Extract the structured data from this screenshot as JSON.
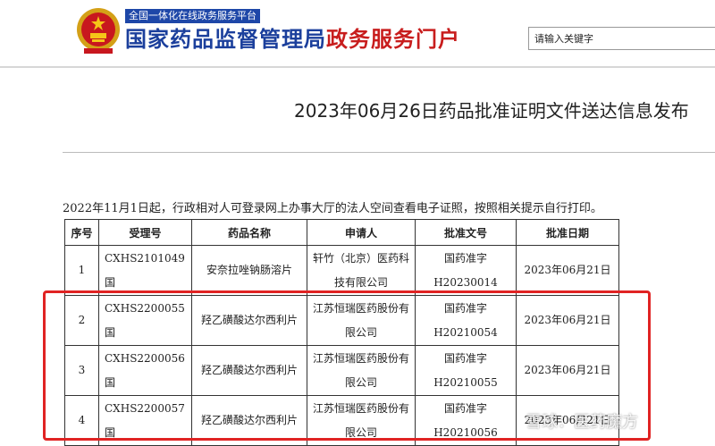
{
  "header": {
    "subtitle": "全国一体化在线政务服务平台",
    "site_title_main": "国家药品监督管理局",
    "site_title_accent": "政务服务门户",
    "search_placeholder": "请输入关键字"
  },
  "page_title": "2023年06月26日药品批准证明文件送达信息发布",
  "notice": "2022年11月1日起，行政相对人可登录网上办事大厅的法人空间查看电子证照，按照相关提示自行打印。",
  "table": {
    "headers": [
      "序号",
      "受理号",
      "药品名称",
      "申请人",
      "批准文号",
      "批准日期"
    ],
    "rows": [
      {
        "index": "1",
        "acceptance_no": "CXHS2101049国",
        "drug_name": "安奈拉唑钠肠溶片",
        "applicant": "轩竹（北京）医药科技有限公司",
        "approval_no": "国药准字H20230014",
        "approval_date": "2023年06月21日"
      },
      {
        "index": "2",
        "acceptance_no": "CXHS2200055国",
        "drug_name": "羟乙磺酸达尔西利片",
        "applicant": "江苏恒瑞医药股份有限公司",
        "approval_no": "国药准字H20210054",
        "approval_date": "2023年06月21日"
      },
      {
        "index": "3",
        "acceptance_no": "CXHS2200056国",
        "drug_name": "羟乙磺酸达尔西利片",
        "applicant": "江苏恒瑞医药股份有限公司",
        "approval_no": "国药准字H20210055",
        "approval_date": "2023年06月21日"
      },
      {
        "index": "4",
        "acceptance_no": "CXHS2200057国",
        "drug_name": "羟乙磺酸达尔西利片",
        "applicant": "江苏恒瑞医药股份有限公司",
        "approval_no": "国药准字H20210056",
        "approval_date": "2023年06月21日"
      }
    ]
  },
  "watermark": "雪球：医药魔方",
  "colors": {
    "brand_blue": "#1b3f9c",
    "brand_red": "#c81d1d",
    "highlight": "#e02323"
  }
}
